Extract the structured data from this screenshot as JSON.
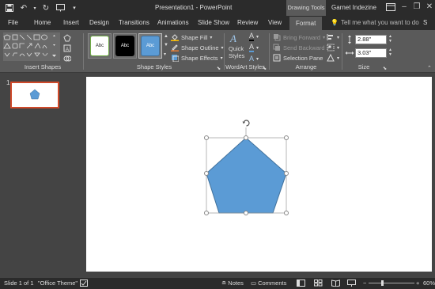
{
  "window": {
    "title": "Presentation1 - PowerPoint",
    "contextual_tab_group": "Drawing Tools",
    "user_name": "Garnet Indezine"
  },
  "tabs": [
    {
      "label": "File"
    },
    {
      "label": "Home"
    },
    {
      "label": "Insert"
    },
    {
      "label": "Design"
    },
    {
      "label": "Transitions"
    },
    {
      "label": "Animations"
    },
    {
      "label": "Slide Show"
    },
    {
      "label": "Review"
    },
    {
      "label": "View"
    },
    {
      "label": "Format",
      "active": true
    }
  ],
  "tell_me": "Tell me what you want to do",
  "share": "S",
  "ribbon": {
    "insert_shapes_label": "Insert Shapes",
    "shape_styles_label": "Shape Styles",
    "style_thumbs": [
      {
        "text": "Abc",
        "bg": "#ffffff",
        "border": "#70ad47",
        "fg": "#222222"
      },
      {
        "text": "Abc",
        "bg": "#000000",
        "border": "#000000",
        "fg": "#ffffff"
      },
      {
        "text": "Abc",
        "bg": "#5b9bd5",
        "border": "#41719c",
        "fg": "#ffffff"
      }
    ],
    "shape_fill": "Shape Fill",
    "shape_outline": "Shape Outline",
    "shape_effects": "Shape Effects",
    "quick_styles_line1": "Quick",
    "quick_styles_line2": "Styles",
    "wordart_label": "WordArt Styles",
    "bring_forward": "Bring Forward",
    "send_backward": "Send Backward",
    "selection_pane": "Selection Pane",
    "arrange_label": "Arrange",
    "height": "2.88\"",
    "width": "3.03\"",
    "size_label": "Size"
  },
  "thumbnails": {
    "number": "1"
  },
  "shape": {
    "fill": "#5b9bd5",
    "outline": "#41719c"
  },
  "status": {
    "slide_info": "Slide 1 of 1",
    "theme": "\"Office Theme\"",
    "notes": "Notes",
    "comments": "Comments",
    "zoom_minus": "−",
    "zoom_plus": "+",
    "zoom": "60%"
  }
}
